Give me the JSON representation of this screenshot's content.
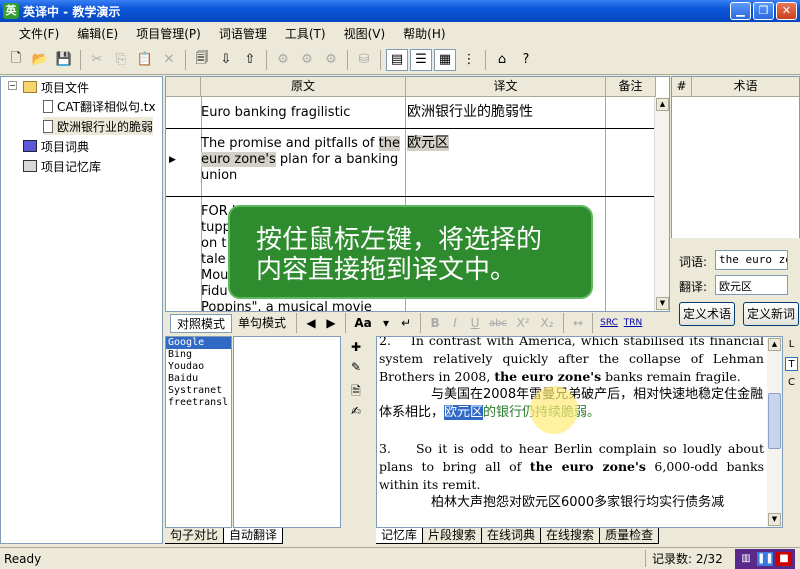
{
  "window": {
    "title": "英译中 - 教学演示",
    "app_icon": "英"
  },
  "menu": [
    "文件(F)",
    "编辑(E)",
    "项目管理(P)",
    "词语管理",
    "工具(T)",
    "视图(V)",
    "帮助(H)"
  ],
  "tree": {
    "project_files": "项目文件",
    "file1": "CAT翻译相似句.tx",
    "file2": "欧洲银行业的脆弱",
    "dictionary": "项目词典",
    "memory": "项目记忆库"
  },
  "grid": {
    "headers": {
      "source": "原文",
      "target": "译文",
      "note": "备注"
    },
    "row1": {
      "source": "Euro banking fragilistic",
      "target": "欧洲银行业的脆弱性"
    },
    "row2": {
      "source_pre": "The promise and pitfalls of ",
      "source_hl": "the euro zone's",
      "source_post": " plan for a banking union",
      "target": "欧元区"
    },
    "row3": {
      "source": "FOR lovers of childhood tuppence ... on t... tale... Mou... Fidu... Poppins\", a musical movie",
      "line1": "FOR lovers of child'",
      "line2": "tupp",
      "line3": "on t",
      "line4": "tale",
      "line5": "Mou",
      "line6": "Fidu",
      "line7": "Poppins\", a musical movie"
    }
  },
  "terms": {
    "headers": {
      "num": "#",
      "term": "术语"
    },
    "word_label": "词语:",
    "word_value": "the euro zor",
    "trans_label": "翻译:",
    "trans_value": "欧元区",
    "define_term": "定义术语",
    "define_new": "定义新词"
  },
  "modebar": {
    "mode1": "对照模式",
    "mode2": "单句模式",
    "font": "Aa",
    "bold": "B",
    "italic": "I",
    "underline": "U",
    "strike": "abc",
    "sup": "X²",
    "sub": "X₂",
    "src": "SRC",
    "trn": "TRN"
  },
  "engines": [
    "Google",
    "Bing",
    "Youdao",
    "Baidu",
    "Systranet",
    "freetransl"
  ],
  "reference": {
    "p1_num": "2.",
    "p1_text": "In contrast with America, which stabilised its financial system relatively quickly after the collapse of Lehman Brothers in 2008, ",
    "p1_bold": "the euro zone's",
    "p1_end": " banks remain fragile.",
    "cn1_pre": "与美国在2008年雷曼兄弟破产后，相对快速地稳定住金融体系相比，",
    "cn1_sel": "欧元区",
    "cn1_mid": "的银行仍",
    "cn1_post": "持续脆弱。",
    "p2_num": "3.",
    "p2_text": "So it is odd to hear Berlin complain so loudly about plans to bring all of ",
    "p2_bold": "the euro zone's",
    "p2_end": " 6,000-odd banks within its remit.",
    "cn2": "柏林大声抱怨对欧元区6000多家银行均实行债务减"
  },
  "right_icons": [
    "L",
    "T",
    "C"
  ],
  "bottom_tabs_left": [
    "句子对比",
    "自动翻译"
  ],
  "bottom_tabs_right": [
    "记忆库",
    "片段搜索",
    "在线词典",
    "在线搜索",
    "质量检查"
  ],
  "status": {
    "ready": "Ready",
    "count": "记录数: 2/32"
  },
  "overlay": {
    "line1": "按住鼠标左键，将选择的",
    "line2": "内容直接拖到译文中。"
  },
  "colors": {
    "title_blue": "#0a55d8",
    "overlay_green": "#2e8b2e",
    "selection": "#316ac5"
  }
}
